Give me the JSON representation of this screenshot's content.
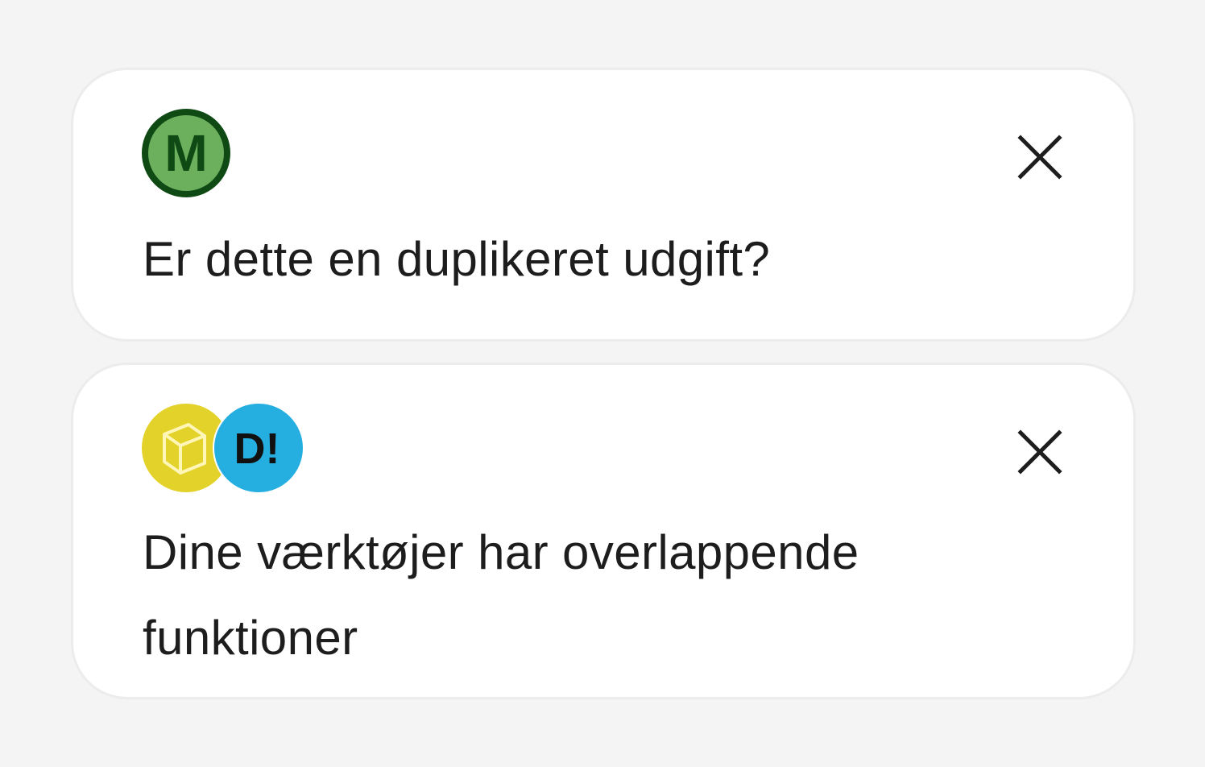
{
  "notifications": [
    {
      "message": "Er dette en duplikeret udgift?",
      "logos": [
        {
          "icon": "m-circle-icon",
          "letter": "M",
          "fill": "#6cb05e",
          "ring": "#0f4a15",
          "text_color": "#0f4a15"
        }
      ],
      "close_icon": "close-icon"
    },
    {
      "message": "Dine værktøjer har overlappende funktioner",
      "logos": [
        {
          "icon": "cube-icon",
          "fill": "#e3d229",
          "stroke": "#fff6b8"
        },
        {
          "icon": "d-exclaim-icon",
          "letter": "D!",
          "fill": "#25aee0",
          "text_color": "#111111"
        }
      ],
      "close_icon": "close-icon"
    }
  ]
}
